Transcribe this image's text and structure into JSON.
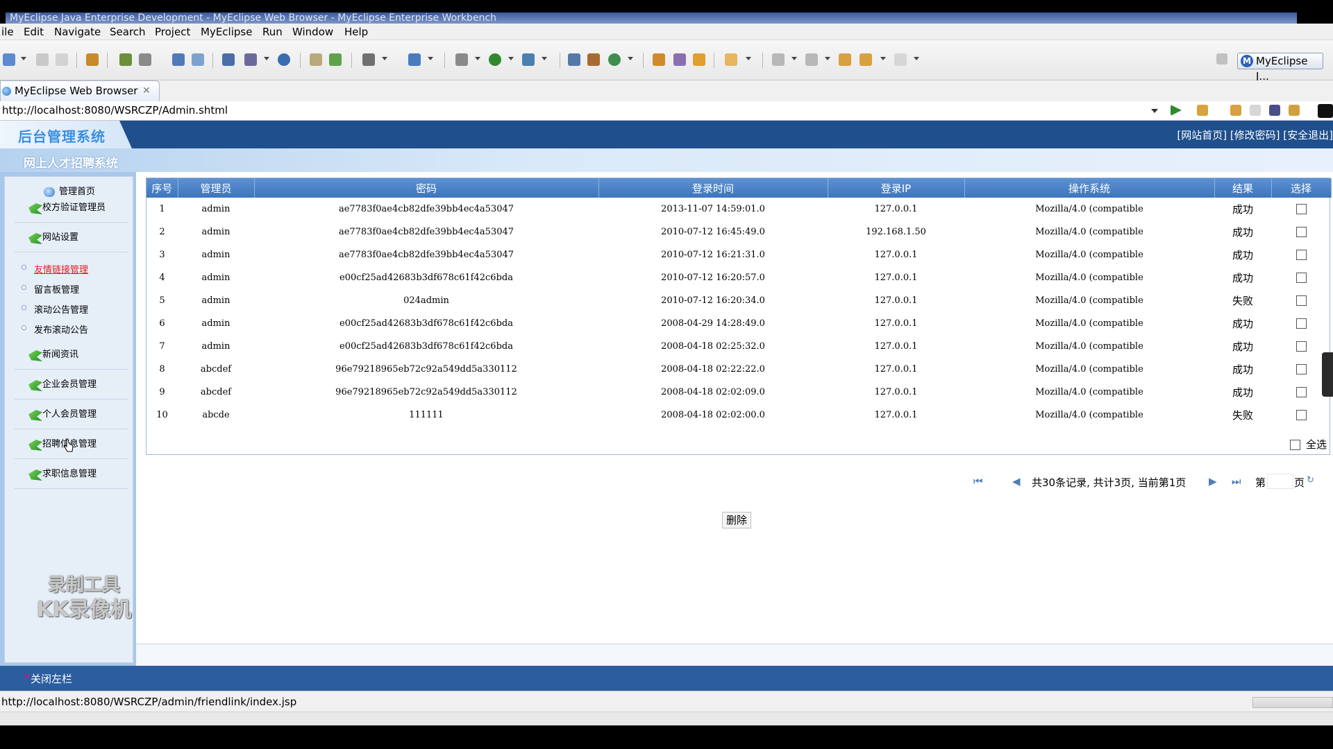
{
  "window": {
    "title": "MyEclipse Java Enterprise Development - MyEclipse Web Browser - MyEclipse Enterprise Workbench"
  },
  "menubar": [
    "ile",
    "Edit",
    "Navigate",
    "Search",
    "Project",
    "MyEclipse",
    "Run",
    "Window",
    "Help"
  ],
  "perspective": {
    "label": "MyEclipse J...",
    "icon": "myeclipse-icon"
  },
  "browser_tab": {
    "label": "MyEclipse Web Browser",
    "close": "✕"
  },
  "address": {
    "url": "http://localhost:8080/WSRCZP/Admin.shtml"
  },
  "app": {
    "title": "后台管理系统",
    "subtitle": "网上人才招聘系统",
    "top_links": "[网站首页] [修改密码] [安全退出]"
  },
  "sidebar": {
    "home": "管理首页",
    "items_top": [
      "校方验证管理员",
      "网站设置"
    ],
    "sub_items": [
      {
        "label": "友情链接管理",
        "active": true
      },
      {
        "label": "留言板管理",
        "active": false
      },
      {
        "label": "滚动公告管理",
        "active": false
      },
      {
        "label": "发布滚动公告",
        "active": false
      }
    ],
    "items_bottom": [
      "新闻资讯",
      "企业会员管理",
      "个人会员管理",
      "招聘信息管理",
      "求职信息管理"
    ],
    "watermark": [
      "录制工具",
      "KK录像机"
    ]
  },
  "table": {
    "headers": [
      "序号",
      "管理员",
      "密码",
      "登录时间",
      "登录IP",
      "操作系统",
      "结果",
      "选择"
    ],
    "rows": [
      [
        "1",
        "admin",
        "ae7783f0ae4cb82dfe39bb4ec4a53047",
        "2013-11-07 14:59:01.0",
        "127.0.0.1",
        "Mozilla/4.0 (compatible",
        "成功"
      ],
      [
        "2",
        "admin",
        "ae7783f0ae4cb82dfe39bb4ec4a53047",
        "2010-07-12 16:45:49.0",
        "192.168.1.50",
        "Mozilla/4.0 (compatible",
        "成功"
      ],
      [
        "3",
        "admin",
        "ae7783f0ae4cb82dfe39bb4ec4a53047",
        "2010-07-12 16:21:31.0",
        "127.0.0.1",
        "Mozilla/4.0 (compatible",
        "成功"
      ],
      [
        "4",
        "admin",
        "e00cf25ad42683b3df678c61f42c6bda",
        "2010-07-12 16:20:57.0",
        "127.0.0.1",
        "Mozilla/4.0 (compatible",
        "成功"
      ],
      [
        "5",
        "admin",
        "024admin",
        "2010-07-12 16:20:34.0",
        "127.0.0.1",
        "Mozilla/4.0 (compatible",
        "失败"
      ],
      [
        "6",
        "admin",
        "e00cf25ad42683b3df678c61f42c6bda",
        "2008-04-29 14:28:49.0",
        "127.0.0.1",
        "Mozilla/4.0 (compatible",
        "成功"
      ],
      [
        "7",
        "admin",
        "e00cf25ad42683b3df678c61f42c6bda",
        "2008-04-18 02:25:32.0",
        "127.0.0.1",
        "Mozilla/4.0 (compatible",
        "成功"
      ],
      [
        "8",
        "abcdef",
        "96e79218965eb72c92a549dd5a330112",
        "2008-04-18 02:22:22.0",
        "127.0.0.1",
        "Mozilla/4.0 (compatible",
        "成功"
      ],
      [
        "9",
        "abcdef",
        "96e79218965eb72c92a549dd5a330112",
        "2008-04-18 02:02:09.0",
        "127.0.0.1",
        "Mozilla/4.0 (compatible",
        "成功"
      ],
      [
        "10",
        "abcde",
        "111111",
        "2008-04-18 02:02:00.0",
        "127.0.0.1",
        "Mozilla/4.0 (compatible",
        "失败"
      ]
    ],
    "select_all": "全选"
  },
  "pager": {
    "summary": "共30条记录, 共计3页, 当前第1页",
    "goto_prefix": "第",
    "goto_suffix": "页",
    "first": "⏮",
    "prev": "◀",
    "next": "▶",
    "last": "⏭"
  },
  "actions": {
    "delete": "删除"
  },
  "close_sidebar": "关闭左栏",
  "status": {
    "url": "http://localhost:8080/WSRCZP/admin/friendlink/index.jsp"
  },
  "colors": {
    "header_blue": "#1f4f8c",
    "table_header": "#4a82c6",
    "link_red": "#e02020"
  }
}
